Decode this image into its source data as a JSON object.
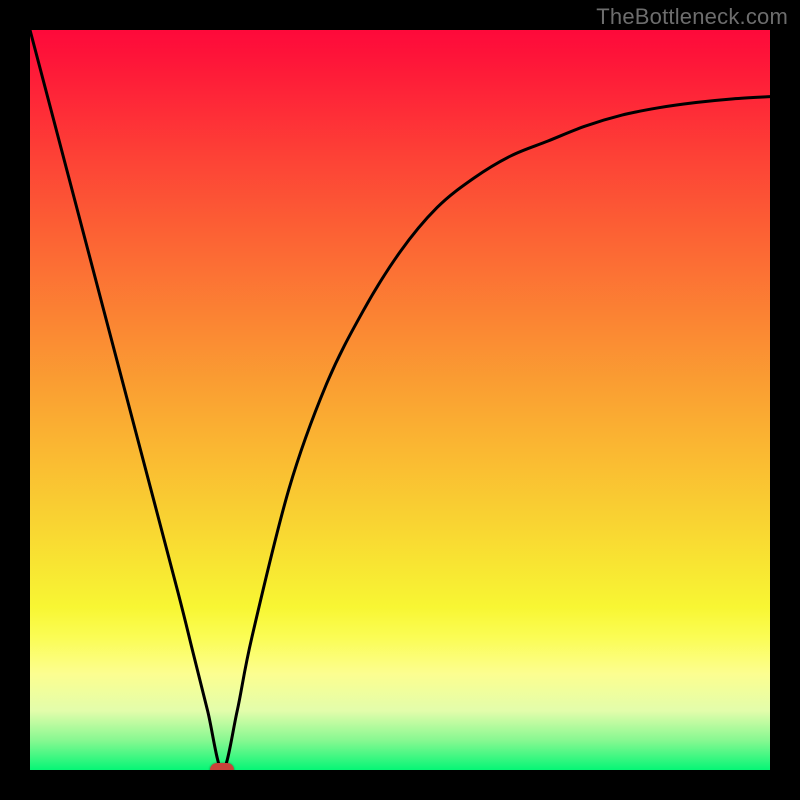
{
  "attribution": "TheBottleneck.com",
  "colors": {
    "frame": "#000000",
    "marker": "#c9433a",
    "curve": "#000000",
    "gradient_stops": [
      {
        "offset": 0.0,
        "color": "#fe093a"
      },
      {
        "offset": 0.07,
        "color": "#fe1f38"
      },
      {
        "offset": 0.17,
        "color": "#fd4136"
      },
      {
        "offset": 0.28,
        "color": "#fc6334"
      },
      {
        "offset": 0.4,
        "color": "#fb8733"
      },
      {
        "offset": 0.53,
        "color": "#faad32"
      },
      {
        "offset": 0.66,
        "color": "#f9d232"
      },
      {
        "offset": 0.78,
        "color": "#f8f633"
      },
      {
        "offset": 0.82,
        "color": "#fbfd54"
      },
      {
        "offset": 0.87,
        "color": "#fcfe90"
      },
      {
        "offset": 0.92,
        "color": "#e3fdab"
      },
      {
        "offset": 0.96,
        "color": "#87f891"
      },
      {
        "offset": 1.0,
        "color": "#06f676"
      }
    ]
  },
  "chart_data": {
    "type": "line",
    "title": "",
    "xlabel": "",
    "ylabel": "",
    "xlim": [
      0,
      100
    ],
    "ylim": [
      0,
      100
    ],
    "grid": false,
    "series": [
      {
        "name": "bottleneck-curve",
        "x": [
          0,
          5,
          10,
          15,
          20,
          22,
          24,
          26,
          28,
          30,
          35,
          40,
          45,
          50,
          55,
          60,
          65,
          70,
          75,
          80,
          85,
          90,
          95,
          100
        ],
        "y": [
          100,
          81,
          62,
          43,
          24,
          16,
          8,
          0,
          8,
          18,
          38,
          52,
          62,
          70,
          76,
          80,
          83,
          85,
          87,
          88.5,
          89.5,
          90.2,
          90.7,
          91
        ]
      }
    ],
    "marker": {
      "x": 26,
      "y": 0
    },
    "legend": false
  }
}
